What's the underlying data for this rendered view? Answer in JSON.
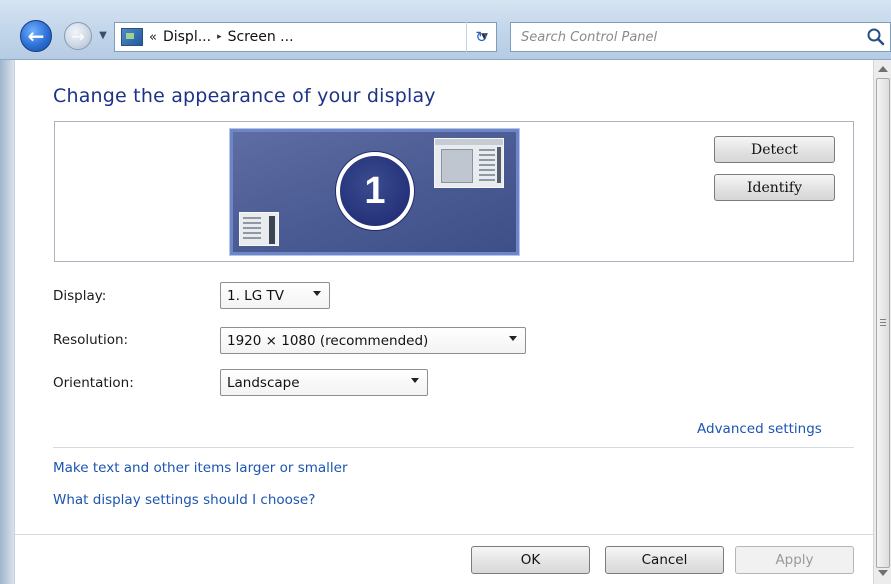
{
  "address_bar": {
    "prefix": "«",
    "crumbs": [
      "Displ...",
      "Screen ..."
    ],
    "separator": "▸"
  },
  "search": {
    "placeholder": "Search Control Panel"
  },
  "page": {
    "title": "Change the appearance of your display"
  },
  "monitor": {
    "number": "1"
  },
  "panel_buttons": {
    "detect": "Detect",
    "identify": "Identify"
  },
  "settings": {
    "display": {
      "label": "Display:",
      "value": "1. LG TV"
    },
    "resolution": {
      "label": "Resolution:",
      "value": "1920 × 1080 (recommended)"
    },
    "orientation": {
      "label": "Orientation:",
      "value": "Landscape"
    }
  },
  "links": {
    "advanced": "Advanced settings",
    "text_size": "Make text and other items larger or smaller",
    "help": "What display settings should I choose?"
  },
  "footer": {
    "ok": "OK",
    "cancel": "Cancel",
    "apply": "Apply"
  },
  "colors": {
    "title_blue": "#1e3287",
    "link_blue": "#1c55b0",
    "monitor_fill": "#4a5a92"
  }
}
